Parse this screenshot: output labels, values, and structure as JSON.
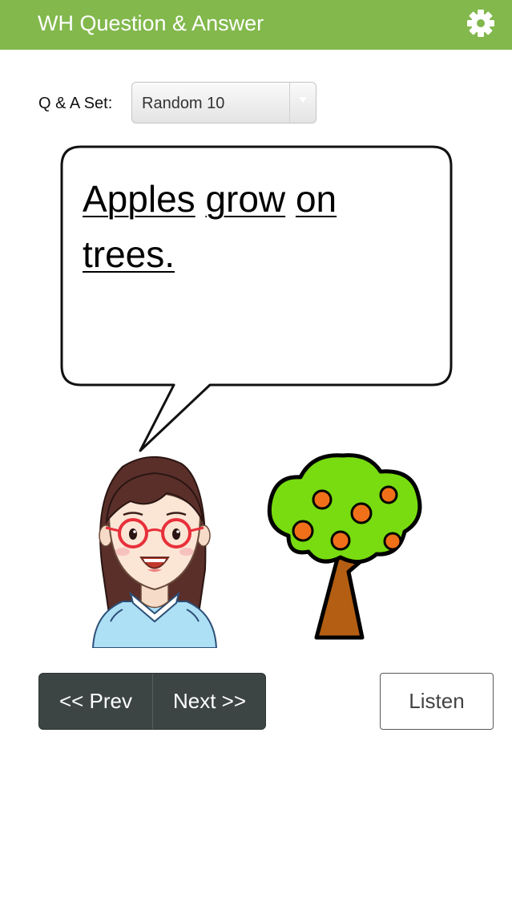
{
  "header": {
    "title": "WH Question & Answer",
    "settings_icon": "gear-icon",
    "background_color": "#82b84c"
  },
  "qa_set": {
    "label": "Q & A Set:",
    "selected": "Random 10"
  },
  "bubble": {
    "words": [
      "Apples",
      "grow",
      "on",
      "trees."
    ]
  },
  "images": {
    "speaker": "girl-with-glasses-illustration",
    "subject": "apple-tree-illustration"
  },
  "nav": {
    "prev_label": "<< Prev",
    "next_label": "Next >>",
    "background_color": "#3d4544"
  },
  "listen_label": "Listen"
}
